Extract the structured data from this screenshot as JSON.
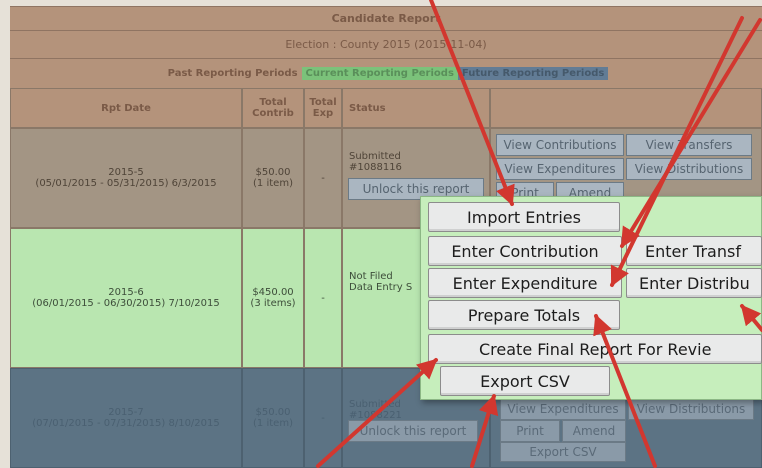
{
  "report": {
    "title": "Candidate Report",
    "election": "Election : County 2015 (2015-11-04)",
    "legend": {
      "past": "Past Reporting Periods",
      "current": "Current Reporting Periods",
      "future": "Future Reporting Periods"
    },
    "columns": [
      "Rpt Date",
      "Total Contrib",
      "Total Exp",
      "Status"
    ],
    "rows": [
      {
        "name": "2015-5",
        "range": "(05/01/2015 - 05/31/2015) 6/3/2015",
        "contrib": "$50.00",
        "contrib_items": "(1 item)",
        "exp": "-",
        "status_line1": "Submitted",
        "status_line2": "#1088116",
        "unlock": "Unlock this report"
      },
      {
        "name": "2015-6",
        "range": "(06/01/2015 - 06/30/2015) 7/10/2015",
        "contrib": "$450.00",
        "contrib_items": "(3 items)",
        "exp": "-",
        "status_line1": "Not Filed",
        "status_line2": "Data Entry S"
      },
      {
        "name": "2015-7",
        "range": "(07/01/2015 - 07/31/2015) 8/10/2015",
        "contrib": "$50.00",
        "contrib_items": "(1 item)",
        "exp": "-",
        "status_line1": "Submitted",
        "status_line2": "#1088221",
        "unlock": "Unlock this report"
      }
    ],
    "row1_actions": {
      "view_contributions": "View Contributions",
      "view_transfers": "View Transfers",
      "view_expenditures": "View Expenditures",
      "view_distributions": "View Distributions",
      "print": "Print",
      "amend": "Amend"
    },
    "row3_actions": {
      "view_expenditures": "View Expenditures",
      "view_distributions": "View Distributions",
      "print": "Print",
      "amend": "Amend",
      "export_csv": "Export CSV"
    }
  },
  "popup": {
    "import_entries": "Import Entries",
    "enter_contribution": "Enter Contribution",
    "enter_transfer": "Enter Transf",
    "enter_expenditure": "Enter Expenditure",
    "enter_distribution": "Enter Distribu",
    "prepare_totals": "Prepare Totals",
    "create_final": "Create Final Report For Revie",
    "export_csv": "Export CSV"
  },
  "colors": {
    "annotation_arrow": "#d2372f",
    "past_row": "#a39584",
    "current_row": "#b9e6b0",
    "future_row": "#5c7384",
    "popup_bg": "#c6eebc"
  }
}
